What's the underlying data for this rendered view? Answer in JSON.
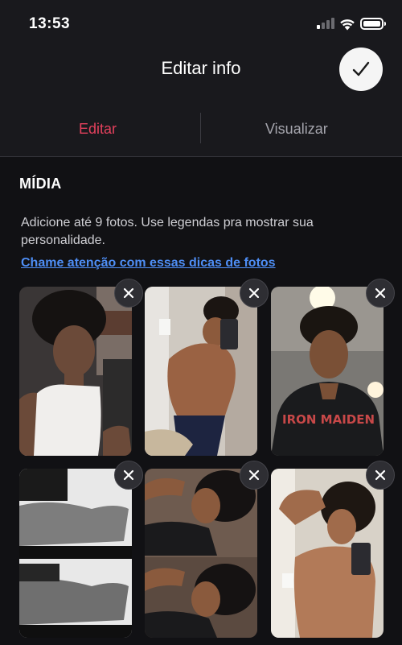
{
  "status_bar": {
    "time": "13:53"
  },
  "header": {
    "title": "Editar info",
    "done_icon": "check-icon"
  },
  "tabs": [
    {
      "label": "Editar",
      "active": true
    },
    {
      "label": "Visualizar",
      "active": false
    }
  ],
  "media": {
    "section_title": "MÍDIA",
    "description": "Adicione até 9 fotos. Use legendas pra mostrar sua personalidade.",
    "tips_link": "Chame atenção com essas dicas de fotos",
    "photos": [
      {
        "remove_icon": "close-icon"
      },
      {
        "remove_icon": "close-icon"
      },
      {
        "remove_icon": "close-icon"
      },
      {
        "remove_icon": "close-icon"
      },
      {
        "remove_icon": "close-icon"
      },
      {
        "remove_icon": "close-icon"
      }
    ]
  },
  "colors": {
    "accent": "#e2405c",
    "link": "#4e8ef5",
    "background": "#111114",
    "header": "#19191d"
  }
}
